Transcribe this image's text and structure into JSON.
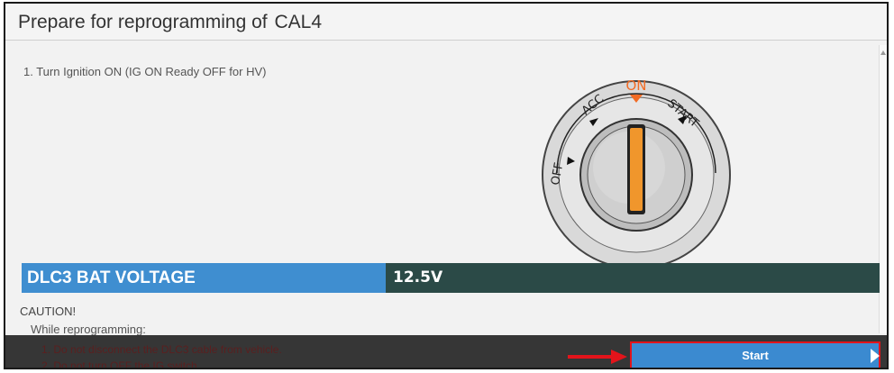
{
  "header": {
    "title": "Prepare for reprogramming of",
    "target": "CAL4"
  },
  "instructions": {
    "step1": "1. Turn Ignition ON (IG ON Ready OFF for HV)"
  },
  "ignition": {
    "positions": [
      "OFF",
      "ACC",
      "ON",
      "START"
    ],
    "on_label": "ON",
    "off_label": "OFF",
    "acc_label": "ACC",
    "start_label": "START",
    "accent_color": "#f26b24",
    "key_color": "#f0962c"
  },
  "voltage": {
    "label": "DLC3 BAT VOLTAGE",
    "value": "12.5V",
    "label_bg": "#3f8ed0",
    "value_bg": "#2b4a47"
  },
  "caution": {
    "title": "CAUTION!",
    "while": "While reprogramming:",
    "items": [
      "1. Do not disconnect the DLC3 cable from vehicle.",
      "2. Do not turn OFF the IG switch."
    ]
  },
  "footer": {
    "start_label": "Start",
    "highlight_color": "#e3141b"
  }
}
